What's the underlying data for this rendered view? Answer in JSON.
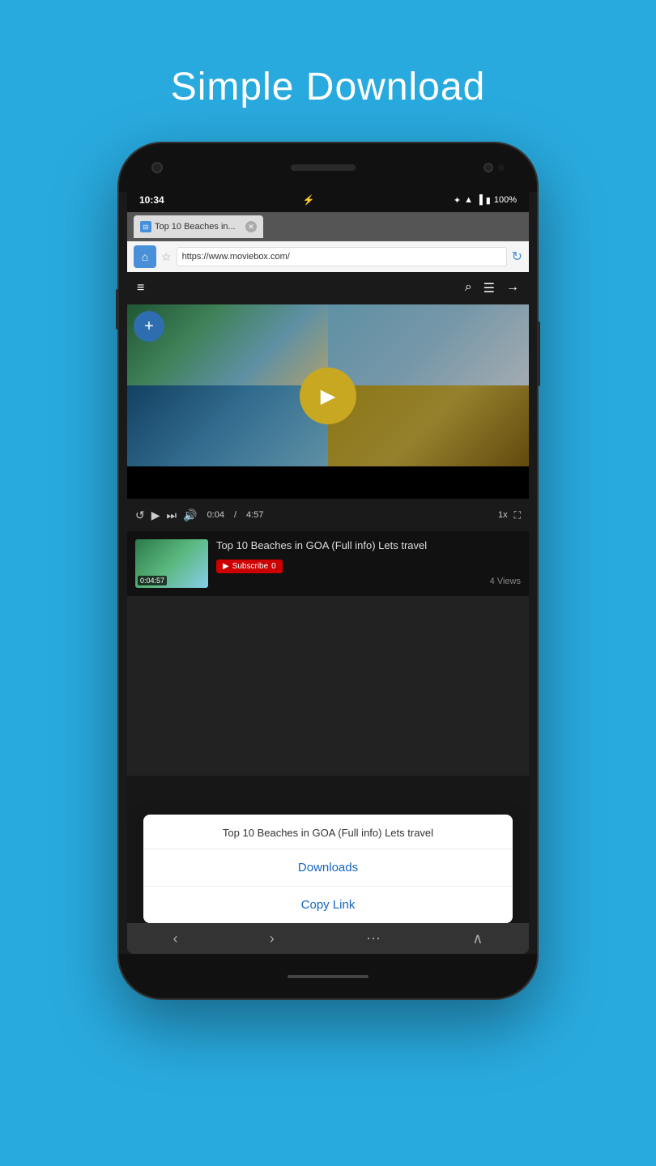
{
  "page": {
    "title": "Simple Download",
    "background_color": "#29aadf"
  },
  "status_bar": {
    "time": "10:34",
    "battery": "100%"
  },
  "browser": {
    "tab_title": "Top 10 Beaches in...",
    "url": "https://www.moviebox.com/"
  },
  "video": {
    "title": "Top 10 Beaches in GOA (Full info) Lets travel",
    "duration": "0:04:57",
    "current_time": "0:04",
    "total_time": "4:57",
    "speed": "1x",
    "views": "4 Views",
    "subscribe_label": "Subscribe"
  },
  "context_menu": {
    "header_text": "Top 10 Beaches in GOA (Full info) Lets travel",
    "items": [
      {
        "label": "Downloads",
        "id": "downloads"
      },
      {
        "label": "Copy Link",
        "id": "copy-link"
      }
    ]
  },
  "nav": {
    "back": "‹",
    "forward": "›",
    "more": "⋯",
    "chevron_up": "∧"
  }
}
